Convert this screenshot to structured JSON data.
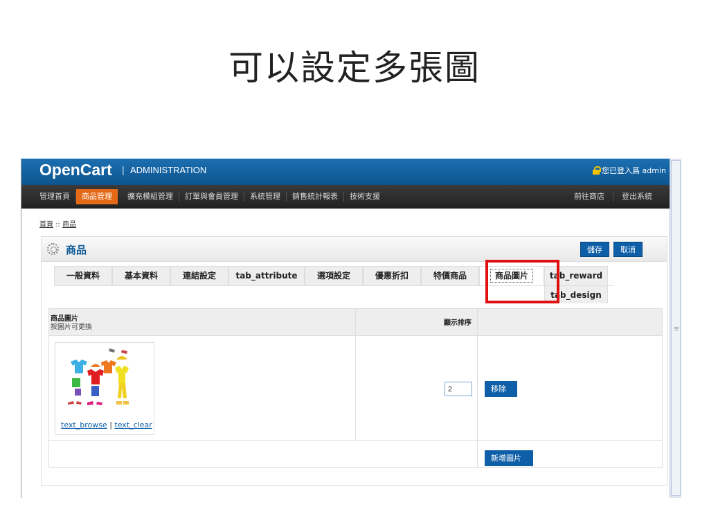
{
  "slide": {
    "title": "可以設定多張圖"
  },
  "header": {
    "logo": "OpenCart",
    "separator": "|",
    "subtitle": "ADMINISTRATION",
    "login_text": "您已登入爲 admin"
  },
  "menu": {
    "items": [
      "管理首頁",
      "商品管理",
      "擴充模組管理",
      "訂單與會員管理",
      "系統管理",
      "銷售統計報表",
      "技術支援"
    ],
    "right": [
      "前往商店",
      "登出系統"
    ]
  },
  "breadcrumb": {
    "home": "首頁",
    "sep": "::",
    "current": "商品"
  },
  "box": {
    "title": "商品",
    "save": "儲存",
    "cancel": "取消"
  },
  "tabs": [
    "一般資料",
    "基本資料",
    "連結設定",
    "tab_attribute",
    "選項設定",
    "優惠折扣",
    "特價商品",
    "商品圖片",
    "tab_reward",
    "tab_design"
  ],
  "grid": {
    "col_image_title": "商品圖片",
    "col_image_sub": "按圖片可更換",
    "col_sort": "顯示排序",
    "row": {
      "link_browse": "text_browse",
      "link_sep": "|",
      "link_clear": "text_clear",
      "sort_value": "2",
      "remove": "移除"
    },
    "add_button": "新增圖片"
  },
  "colors": {
    "header_blue": "#1c6fb0",
    "active_orange": "#e56a17",
    "button_blue": "#0e5ea8",
    "highlight_red": "#e01010"
  }
}
